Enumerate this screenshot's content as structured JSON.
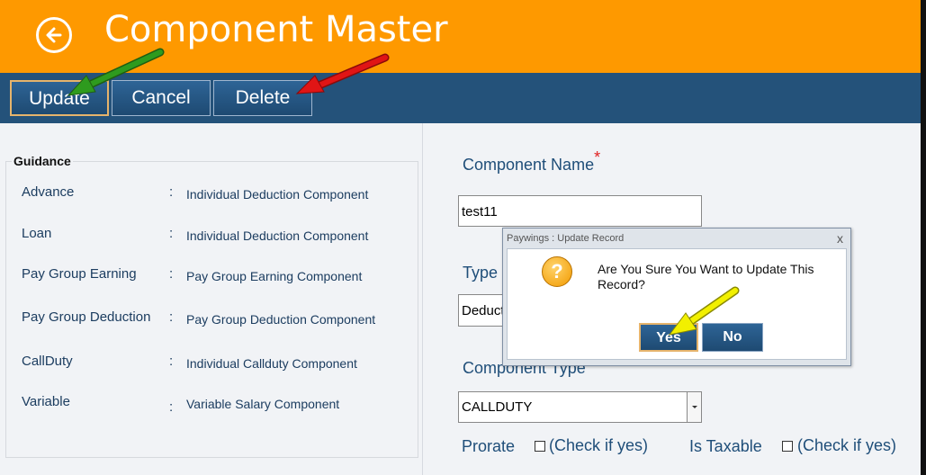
{
  "header": {
    "title": "Component Master"
  },
  "toolbar": {
    "update_label": "Update",
    "cancel_label": "Cancel",
    "delete_label": "Delete"
  },
  "guidance": {
    "title": "Guidance",
    "rows": [
      {
        "key": "Advance",
        "value": "Individual Deduction Component"
      },
      {
        "key": "Loan",
        "value": "Individual Deduction Component"
      },
      {
        "key": "Pay Group Earning",
        "value": "Pay Group Earning Component"
      },
      {
        "key": "Pay Group Deduction",
        "value": "Pay Group Deduction Component"
      },
      {
        "key": "CallDuty",
        "value": "Individual Callduty Component"
      },
      {
        "key": "Variable",
        "value": "Variable Salary Component"
      }
    ],
    "separator": ":"
  },
  "form": {
    "component_name_label": "Component Name",
    "required_mark": "*",
    "component_name_value": "test11",
    "type_label": "Type",
    "type_value": "Deduct",
    "component_type_label": "Component Type",
    "component_type_value": "CALLDUTY",
    "prorate_label": "Prorate",
    "prorate_check_label": "(Check if yes)",
    "taxable_label": "Is Taxable",
    "taxable_check_label": "(Check if yes)"
  },
  "dialog": {
    "title": "Paywings : Update Record",
    "close": "x",
    "icon_glyph": "?",
    "message": "Are You Sure You Want to Update This Record?",
    "yes_label": "Yes",
    "no_label": "No"
  },
  "colors": {
    "header_bg": "#fe9900",
    "toolbar_bg": "#24527a",
    "label_text": "#1f4e79",
    "annotation_green": "#2e8b1e",
    "annotation_red": "#e01515",
    "annotation_yellow": "#f2f000"
  }
}
